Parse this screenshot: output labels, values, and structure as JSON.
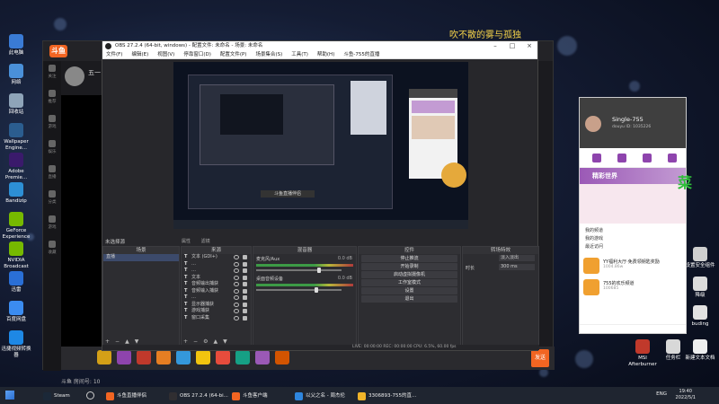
{
  "wallpaper": {
    "caption": "吹不散的雾与孤独"
  },
  "desktop_icons_left": [
    {
      "label": "此电脑",
      "color": "#3a7bd5"
    },
    {
      "label": "网络",
      "color": "#4a90d9"
    },
    {
      "label": "回收站",
      "color": "#8ea4b8"
    },
    {
      "label": "Wallpaper Engine...",
      "color": "#2b5d8f"
    },
    {
      "label": "Adobe Premie...",
      "color": "#3a1a6b"
    },
    {
      "label": "Bandizip",
      "color": "#2d8fd5"
    },
    {
      "label": "GeForce Experience",
      "color": "#76b900"
    },
    {
      "label": "NVIDIA Broadcast",
      "color": "#76b900"
    },
    {
      "label": "迅雷",
      "color": "#2a6fd6"
    },
    {
      "label": "百度网盘",
      "color": "#3b8cf0"
    },
    {
      "label": "迅捷视频转换器",
      "color": "#1e88e5"
    }
  ],
  "desktop_icons_right": [
    {
      "label": "设置安全组件",
      "color": "#cfcfcf"
    },
    {
      "label": "降级",
      "color": "#dcdcdc"
    },
    {
      "label": "buding",
      "color": "#e2e2e2"
    },
    {
      "label": "MSI Afterburner",
      "color": "#c0392b"
    },
    {
      "label": "任务栏",
      "color": "#d8d8d8"
    },
    {
      "label": "新建文本文档",
      "color": "#eeeeee"
    }
  ],
  "douyu": {
    "logo": "斗鱼",
    "room_title": "五一",
    "room_id_label": "斗鱼 房间号: 10",
    "sidebar": [
      "关注",
      "推荐",
      "游戏",
      "娱乐",
      "直播",
      "分类",
      "游戏",
      "收藏"
    ],
    "send_label": "发送",
    "gift_colors": [
      "#d4a017",
      "#8e44ad",
      "#c0392b",
      "#e67e22",
      "#3498db",
      "#f1c40f",
      "#e74c3c",
      "#16a085",
      "#9b59b6",
      "#d35400"
    ]
  },
  "obs": {
    "title": "OBS 27.2.4 (64-bit, windows) - 配置文件: 未命名 - 场景: 未命名",
    "menu": [
      "文件(F)",
      "编辑(E)",
      "视图(V)",
      "停靠窗口(D)",
      "配置文件(P)",
      "场景集合(S)",
      "工具(T)",
      "帮助(H)",
      "斗鱼-755的直播"
    ],
    "status_label": "未选择源",
    "status_tools": [
      "属性",
      "滤镜"
    ],
    "preview_banner": "斗鱼直播伴侣",
    "scenes_header": "场景",
    "scenes": [
      "直播"
    ],
    "sources_header": "来源",
    "sources": [
      {
        "label": "文本 (GDI+)"
      },
      {
        "label": "…"
      },
      {
        "label": "…"
      },
      {
        "label": "文本"
      },
      {
        "label": "音频输出捕获"
      },
      {
        "label": "音频输入捕获"
      },
      {
        "label": "…"
      },
      {
        "label": "显示器捕获"
      },
      {
        "label": "游戏捕获"
      },
      {
        "label": "窗口采集"
      }
    ],
    "mixer_header": "混音器",
    "mixer": [
      {
        "name": "麦克风/Aux",
        "db": "0.0 dB",
        "level": 0.72
      },
      {
        "name": "桌面音频设备",
        "db": "0.0 dB",
        "level": 0.68
      }
    ],
    "controls_header": "控件",
    "controls": [
      "停止推流",
      "开始录制",
      "启动虚拟摄像机",
      "工作室模式",
      "设置",
      "退出"
    ],
    "transitions_header": "转场特效",
    "transition": "淡入淡出",
    "duration_label": "时长",
    "duration": "300 ms",
    "status_bar": "LIVE: 00:00:00   REC: 00:00:00   CPU: 6.5%, 60.00 fps"
  },
  "rpanel": {
    "name": "Single-755",
    "sub": "douyu ID: 1035226",
    "banner": "精彩世界",
    "links": [
      "我的频道",
      "我的游戏",
      "最近访问"
    ],
    "items": [
      {
        "title": "YY福利大厅·免费领钥匙奖励",
        "meta": "1004.86w"
      },
      {
        "title": "755的欢乐频道",
        "meta": "100685"
      }
    ]
  },
  "green_char": "菜",
  "taskbar": {
    "apps": [
      "Steam",
      "斗鱼直播伴侣",
      "OBS 27.2.4 (64-bi...",
      "斗鱼客户端",
      "以父之名 - 周杰伦",
      "3306893-755的直..."
    ],
    "lang": "ENG",
    "time": "19:40",
    "date": "2022/5/1"
  }
}
